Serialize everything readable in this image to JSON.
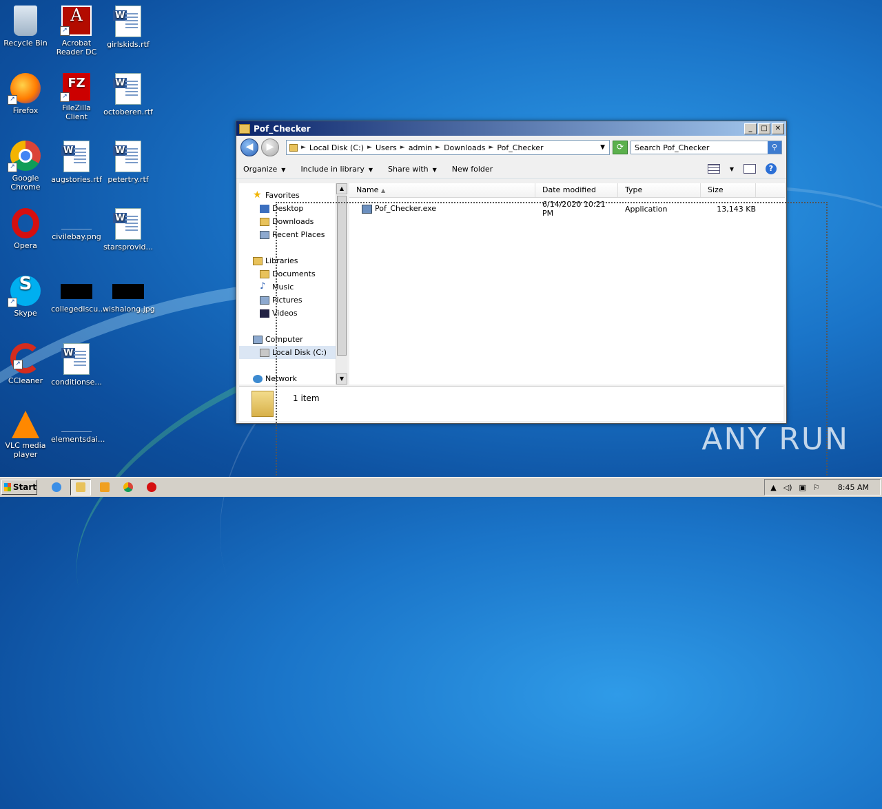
{
  "desktop": {
    "icons": [
      {
        "label": "Recycle Bin",
        "icon": "recycle-bin-icon"
      },
      {
        "label": "Acrobat Reader DC",
        "icon": "acrobat-icon"
      },
      {
        "label": "girlskids.rtf",
        "icon": "word-doc-icon"
      },
      {
        "label": "Firefox",
        "icon": "firefox-icon"
      },
      {
        "label": "FileZilla Client",
        "icon": "filezilla-icon"
      },
      {
        "label": "octoberen.rtf",
        "icon": "word-doc-icon"
      },
      {
        "label": "Google Chrome",
        "icon": "chrome-icon"
      },
      {
        "label": "augstories.rtf",
        "icon": "word-doc-icon"
      },
      {
        "label": "petertry.rtf",
        "icon": "word-doc-icon"
      },
      {
        "label": "Opera",
        "icon": "opera-icon"
      },
      {
        "label": "civilebay.png",
        "icon": "image-file-icon"
      },
      {
        "label": "starsprovid...",
        "icon": "word-doc-icon"
      },
      {
        "label": "Skype",
        "icon": "skype-icon"
      },
      {
        "label": "collegediscu...",
        "icon": "image-file-icon"
      },
      {
        "label": "wishalong.jpg",
        "icon": "image-file-icon"
      },
      {
        "label": "CCleaner",
        "icon": "ccleaner-icon"
      },
      {
        "label": "conditionse...",
        "icon": "word-doc-icon"
      },
      {
        "label": "VLC media player",
        "icon": "vlc-icon"
      },
      {
        "label": "elementsdai...",
        "icon": "image-file-icon"
      }
    ]
  },
  "window": {
    "title": "Pof_Checker",
    "controls": {
      "minimize": "_",
      "maximize": "□",
      "close": "✕"
    },
    "breadcrumb": [
      "Local Disk (C:)",
      "Users",
      "admin",
      "Downloads",
      "Pof_Checker"
    ],
    "search_placeholder": "Search Pof_Checker",
    "commands": [
      "Organize",
      "Include in library",
      "Share with",
      "New folder"
    ],
    "nav": {
      "favorites": "Favorites",
      "favorites_items": [
        "Desktop",
        "Downloads",
        "Recent Places"
      ],
      "libraries": "Libraries",
      "libraries_items": [
        "Documents",
        "Music",
        "Pictures",
        "Videos"
      ],
      "computer": "Computer",
      "computer_items": [
        "Local Disk (C:)"
      ],
      "network": "Network"
    },
    "columns": [
      "Name",
      "Date modified",
      "Type",
      "Size"
    ],
    "files": [
      {
        "name": "Pof_Checker.exe",
        "date": "6/14/2020 10:21 PM",
        "type": "Application",
        "size": "13,143 KB"
      }
    ],
    "item_count": "1 item"
  },
  "watermark": "ANY RUN",
  "taskbar": {
    "start_label": "Start",
    "time": "8:45 AM"
  }
}
